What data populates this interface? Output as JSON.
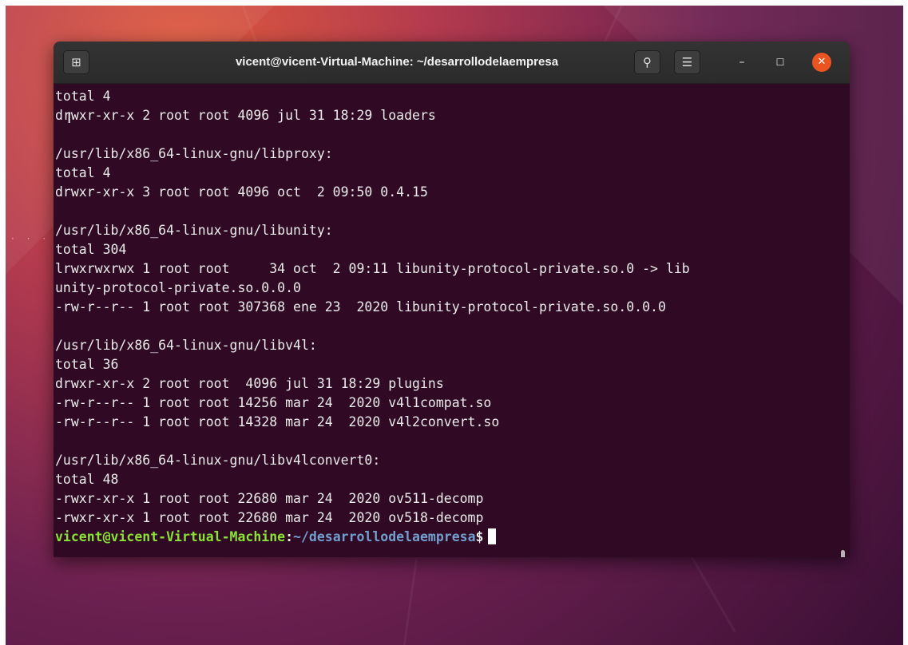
{
  "window": {
    "title": "vicent@vicent-Virtual-Machine: ~/desarrollodelaempresa"
  },
  "titlebar": {
    "new_tab_icon": "new-tab-icon",
    "search_icon": "search-icon",
    "menu_icon": "hamburger-menu-icon",
    "minimize_icon": "minimize-icon",
    "maximize_icon": "maximize-icon",
    "close_icon": "close-icon",
    "new_tab_glyph": "⊞",
    "search_glyph": "⚲",
    "menu_glyph": "☰",
    "minimize_glyph": "–",
    "maximize_glyph": "☐",
    "close_glyph": "✕"
  },
  "terminal": {
    "lines": [
      "total 4",
      "drwxr-xr-x 2 root root 4096 jul 31 18:29 loaders",
      "",
      "/usr/lib/x86_64-linux-gnu/libproxy:",
      "total 4",
      "drwxr-xr-x 3 root root 4096 oct  2 09:50 0.4.15",
      "",
      "/usr/lib/x86_64-linux-gnu/libunity:",
      "total 304",
      "lrwxrwxrwx 1 root root     34 oct  2 09:11 libunity-protocol-private.so.0 -> lib",
      "unity-protocol-private.so.0.0.0",
      "-rw-r--r-- 1 root root 307368 ene 23  2020 libunity-protocol-private.so.0.0.0",
      "",
      "/usr/lib/x86_64-linux-gnu/libv4l:",
      "total 36",
      "drwxr-xr-x 2 root root  4096 jul 31 18:29 plugins",
      "-rw-r--r-- 1 root root 14256 mar 24  2020 v4l1compat.so",
      "-rw-r--r-- 1 root root 14328 mar 24  2020 v4l2convert.so",
      "",
      "/usr/lib/x86_64-linux-gnu/libv4lconvert0:",
      "total 48",
      "-rwxr-xr-x 1 root root 22680 mar 24  2020 ov511-decomp",
      "-rwxr-xr-x 1 root root 22680 mar 24  2020 ov518-decomp"
    ],
    "prompt": {
      "user_host": "vicent@vicent-Virtual-Machine",
      "separator": ":",
      "path": "~/desarrollodelaempresa",
      "symbol": "$"
    }
  },
  "colors": {
    "terminal_background": "#300a24",
    "prompt_user": "#8ae234",
    "prompt_path": "#729fcf",
    "close_button": "#e95420"
  }
}
